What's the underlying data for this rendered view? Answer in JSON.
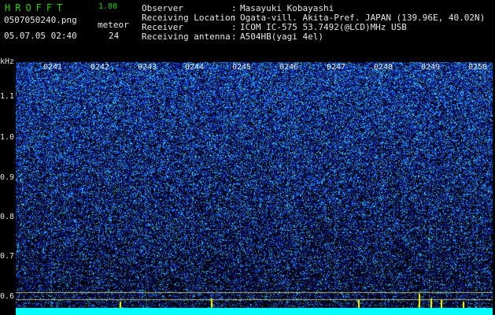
{
  "app": {
    "brand": "HROFFT",
    "version": "1.00"
  },
  "file": {
    "name": "0507050240.png",
    "datetime": "05.07.05 02:40"
  },
  "meteor": {
    "label": "meteor",
    "count": "24"
  },
  "info": [
    {
      "label": "Observer",
      "value": "Masayuki Kobayashi"
    },
    {
      "label": "Receiving Location",
      "value": "Ogata-vill. Akita-Pref. JAPAN (139.96E, 40.02N)"
    },
    {
      "label": "Receiver",
      "value": "ICOM IC-575 53.7492(@LCD)MHz USB"
    },
    {
      "label": "Receiving antenna",
      "value": "A504HB(yagi 4el)"
    }
  ],
  "axis": {
    "unit": "kHz",
    "y_ticks": [
      "1.1",
      "1.0",
      "0.9",
      "0.8",
      "0.7",
      "0.6"
    ],
    "x_ticks": [
      "0241",
      "0242",
      "0243",
      "0244",
      "0245",
      "0246",
      "0247",
      "0248",
      "0249",
      "0250"
    ]
  },
  "colors": {
    "bg": "#000000",
    "noise_low": "#0a1a8a",
    "noise_mid": "#2050ff",
    "noise_high": "#40e0ff",
    "meteor": "#ffff00",
    "baseline": "#00ffff"
  }
}
